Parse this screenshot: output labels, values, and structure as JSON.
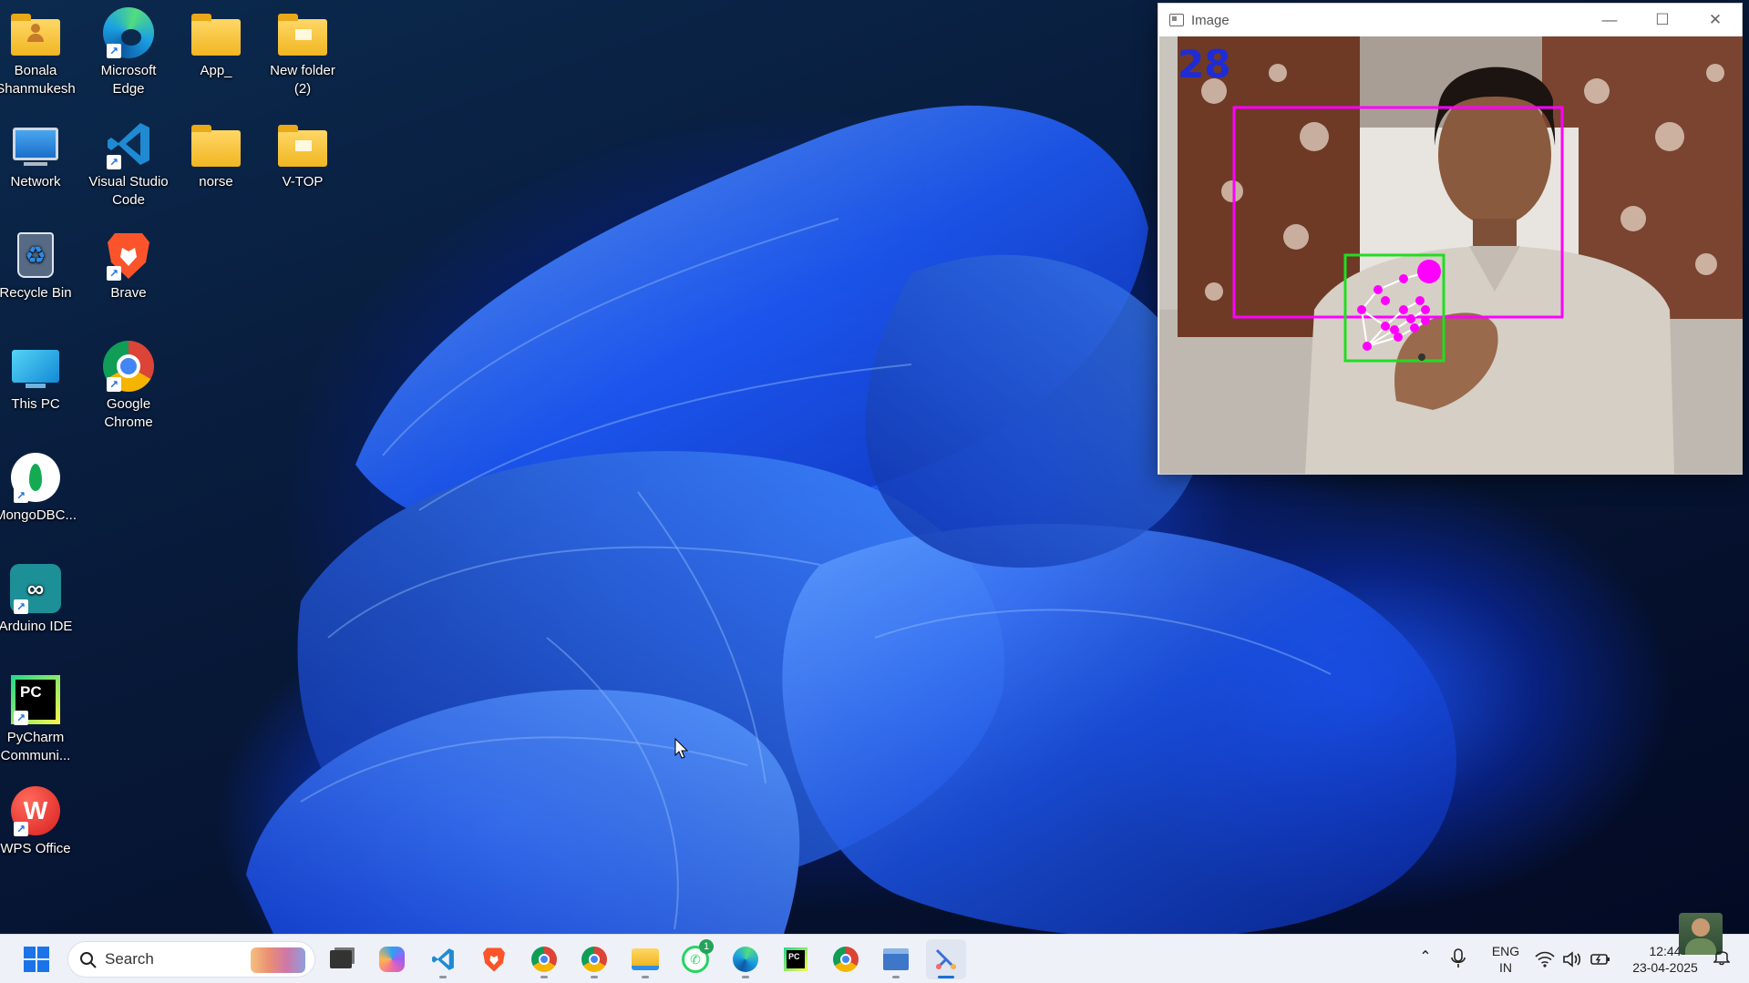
{
  "desktop": {
    "icons": [
      {
        "label": "Bonala Shanmukesh",
        "icon": "user-folder-icon"
      },
      {
        "label": "Microsoft Edge",
        "icon": "edge-icon"
      },
      {
        "label": "App_",
        "icon": "folder-icon"
      },
      {
        "label": "New folder (2)",
        "icon": "folder-icon"
      },
      {
        "label": "Network",
        "icon": "network-icon"
      },
      {
        "label": "Visual Studio Code",
        "icon": "vscode-icon"
      },
      {
        "label": "norse",
        "icon": "folder-icon"
      },
      {
        "label": "V-TOP",
        "icon": "folder-icon"
      },
      {
        "label": "Recycle Bin",
        "icon": "recycle-bin-icon"
      },
      {
        "label": "Brave",
        "icon": "brave-icon"
      },
      {
        "label": "This PC",
        "icon": "monitor-icon"
      },
      {
        "label": "Google Chrome",
        "icon": "chrome-icon"
      },
      {
        "label": "MongoDBC...",
        "icon": "mongodb-icon"
      },
      {
        "label": "Arduino IDE",
        "icon": "arduino-icon"
      },
      {
        "label": "PyCharm Communi...",
        "icon": "pycharm-icon"
      },
      {
        "label": "WPS Office",
        "icon": "wps-icon"
      }
    ]
  },
  "image_window": {
    "title": "Image",
    "counter": "28",
    "controls": [
      "minimize",
      "maximize",
      "close"
    ],
    "colors": {
      "face_box": "#ff00ff",
      "hand_box": "#22dd22",
      "landmarks": "#ff00ff",
      "counter": "#1f2bd6"
    }
  },
  "taskbar": {
    "search_placeholder": "Search",
    "pinned": [
      "task-view-icon",
      "copilot-icon",
      "vscode-icon",
      "brave-icon",
      "chrome-icon",
      "chrome-profile-icon",
      "file-explorer-icon",
      "whatsapp-icon",
      "edge-icon",
      "pycharm-icon",
      "chrome-icon",
      "control-panel-icon",
      "snipping-tool-icon"
    ],
    "whatsapp_badge": "1",
    "tray": {
      "language": "ENG",
      "region": "IN",
      "time": "12:44",
      "date": "23-04-2025"
    }
  }
}
